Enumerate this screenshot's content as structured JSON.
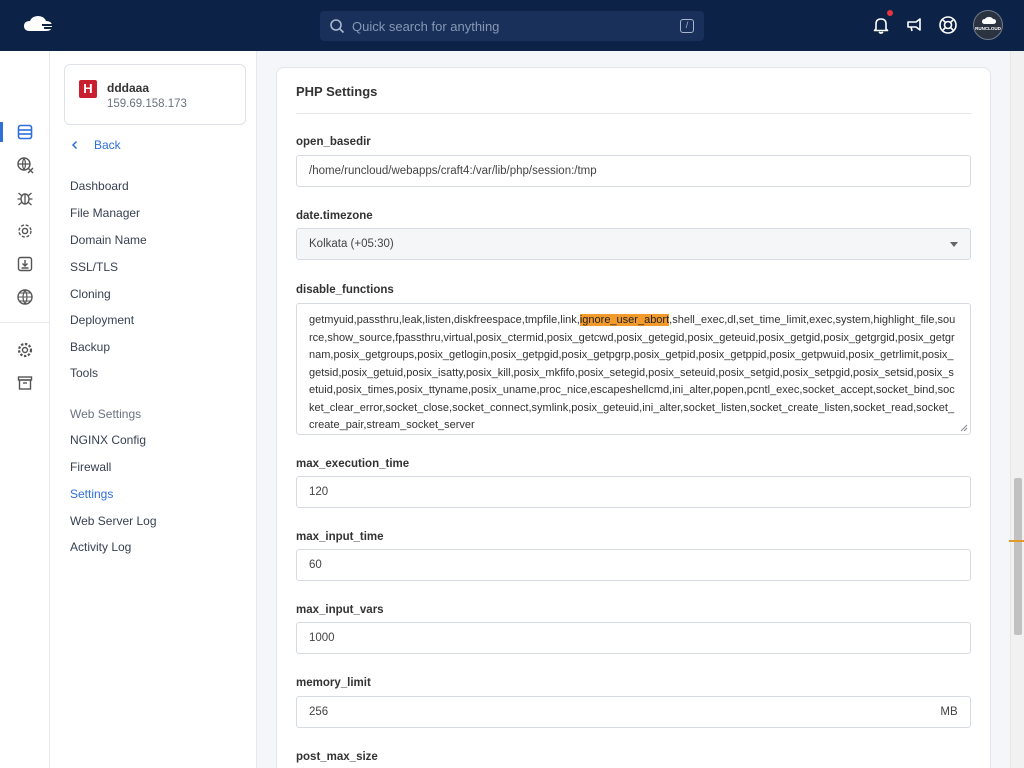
{
  "topbar": {
    "search_placeholder": "Quick search for anything",
    "search_shortcut": "/",
    "avatar_text": "RUNCLOUD"
  },
  "server": {
    "logo_letter": "H",
    "name": "dddaaa",
    "ip": "159.69.158.173"
  },
  "sidebar": {
    "back_label": "Back",
    "items": [
      "Dashboard",
      "File Manager",
      "Domain Name",
      "SSL/TLS",
      "Cloning",
      "Deployment",
      "Backup",
      "Tools"
    ],
    "web_settings_title": "Web Settings",
    "web_items": [
      "NGINX Config",
      "Firewall",
      "Settings",
      "Web Server Log",
      "Activity Log"
    ],
    "active_item": "Settings"
  },
  "php_settings": {
    "title": "PHP Settings",
    "open_basedir": {
      "label": "open_basedir",
      "value": "/home/runcloud/webapps/craft4:/var/lib/php/session:/tmp"
    },
    "date_timezone": {
      "label": "date.timezone",
      "value": "Kolkata (+05:30)"
    },
    "disable_functions": {
      "label": "disable_functions",
      "before": "getmyuid,passthru,leak,listen,diskfreespace,tmpfile,link,",
      "highlight": "ignore_user_abort",
      "after": ",shell_exec,dl,set_time_limit,exec,system,highlight_file,source,show_source,fpassthru,virtual,posix_ctermid,posix_getcwd,posix_getegid,posix_geteuid,posix_getgid,posix_getgrgid,posix_getgrnam,posix_getgroups,posix_getlogin,posix_getpgid,posix_getpgrp,posix_getpid,posix_getppid,posix_getpwuid,posix_getrlimit,posix_getsid,posix_getuid,posix_isatty,posix_kill,posix_mkfifo,posix_setegid,posix_seteuid,posix_setgid,posix_setpgid,posix_setsid,posix_setuid,posix_times,posix_ttyname,posix_uname,proc_nice,escapeshellcmd,ini_alter,popen,pcntl_exec,socket_accept,socket_bind,socket_clear_error,socket_close,socket_connect,symlink,posix_geteuid,ini_alter,socket_listen,socket_create_listen,socket_read,socket_create_pair,stream_socket_server"
    },
    "max_execution_time": {
      "label": "max_execution_time",
      "value": "120"
    },
    "max_input_time": {
      "label": "max_input_time",
      "value": "60"
    },
    "max_input_vars": {
      "label": "max_input_vars",
      "value": "1000"
    },
    "memory_limit": {
      "label": "memory_limit",
      "value": "256",
      "unit": "MB"
    },
    "post_max_size": {
      "label": "post_max_size"
    }
  },
  "colors": {
    "topbar_bg": "#0c2247",
    "accent": "#2e6fd8",
    "highlight": "#f39a2c",
    "server_logo": "#c8202f"
  }
}
